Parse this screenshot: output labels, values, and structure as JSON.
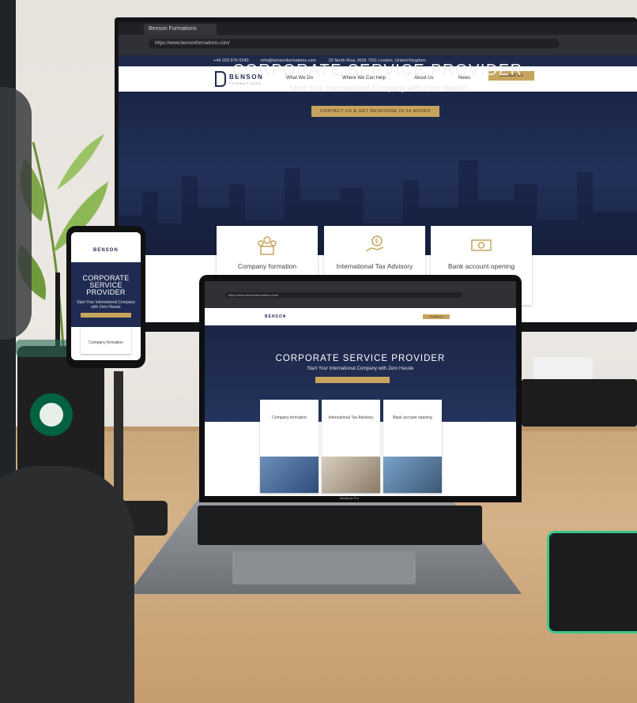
{
  "monitor_site": {
    "tab_title": "Benson Formations",
    "url": "https://www.bensonformations.com/",
    "info_phone": "+44 203 976 0240",
    "info_email": "info@bensonformations.com",
    "info_address": "26 North Row, W1K 7DG London, United Kingdom",
    "logo_main": "BENSON",
    "logo_sub": "FORMATIONS",
    "nav": [
      "What We Do",
      "Where We Can Help",
      "About Us",
      "News"
    ],
    "contact_button": "Contact Us",
    "hero_title": "CORPORATE SERVICE PROVIDER",
    "hero_subtitle": "Start Your International Company with Zero Hassle",
    "hero_cta": "CONTACT US & GET RESPONSE IN 24 HOURS",
    "services": [
      {
        "label": "Company formation",
        "icon": "people-icon"
      },
      {
        "label": "International Tax Advisory",
        "icon": "dollar-hand-icon"
      },
      {
        "label": "Bank account opening",
        "icon": "banknote-icon"
      }
    ]
  },
  "phone_site": {
    "logo": "BENSON",
    "title": "CORPORATE SERVICE PROVIDER",
    "subtitle": "Start Your International Company with Zero Hassle",
    "card_label": "Company formation"
  },
  "laptop_site": {
    "tab_title": "Benson Formations",
    "url": "https://www.bensonformations.com/",
    "logo": "BENSON",
    "contact": "Contact Us",
    "title": "CORPORATE SERVICE PROVIDER",
    "subtitle": "Start Your International Company with Zero Hassle",
    "cards": [
      "Company formation",
      "International Tax Advisory",
      "Bank account opening"
    ],
    "brand_label": "MacBook Pro"
  },
  "colors": {
    "navy": "#1f2a4d",
    "gold": "#c7a45e",
    "starbucks_green": "#006241",
    "mousepad_glow": "#39c98a"
  }
}
